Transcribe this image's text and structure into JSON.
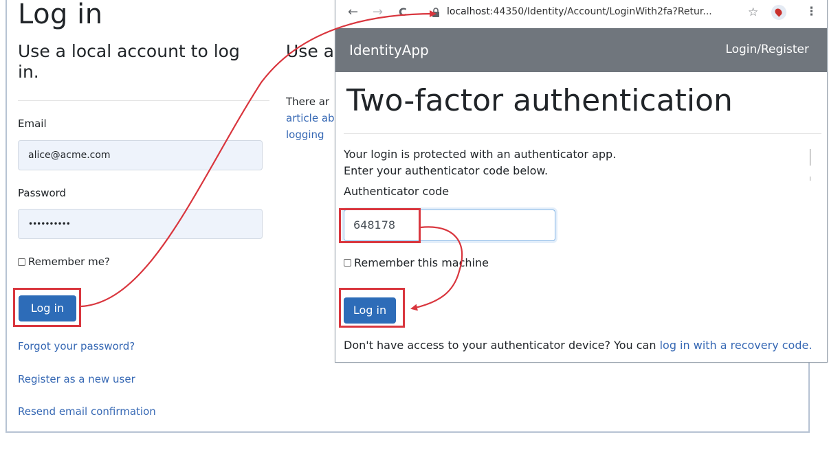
{
  "login_page": {
    "title": "Log in",
    "local_heading": "Use a local account to log in.",
    "external_heading": "Use a",
    "external_text_line1": "There ar",
    "external_text_line2": "article ab",
    "external_text_line3": "logging",
    "email_label": "Email",
    "email_value": "alice@acme.com",
    "password_label": "Password",
    "password_value": "••••••••••",
    "remember_label": "Remember me?",
    "login_button": "Log in",
    "forgot_link": "Forgot your password?",
    "register_link": "Register as a new user",
    "resend_link": "Resend email confirmation"
  },
  "browser": {
    "back_icon": "←",
    "forward_icon": "→",
    "reload_icon": "C",
    "url_host": "localhost",
    "url_rest": ":44350/Identity/Account/LoginWith2fa?Retur...",
    "star_icon": "☆",
    "menu_icon": "⋮"
  },
  "twofa_page": {
    "brand": "IdentityApp",
    "nav_right": "Login/Register",
    "title": "Two-factor authentication",
    "desc_line1": "Your login is protected with an authenticator app.",
    "desc_line2": "Enter your authenticator code below.",
    "code_label": "Authenticator code",
    "code_value": "648178",
    "remember_label": "Remember this machine",
    "login_button": "Log in",
    "recovery_text": "Don't have access to your authenticator device? You can ",
    "recovery_link": "log in with a recovery code."
  },
  "colors": {
    "primary": "#2d6cb8",
    "link": "#3668b4",
    "navbar": "#70767d",
    "highlight": "#d9363e"
  }
}
